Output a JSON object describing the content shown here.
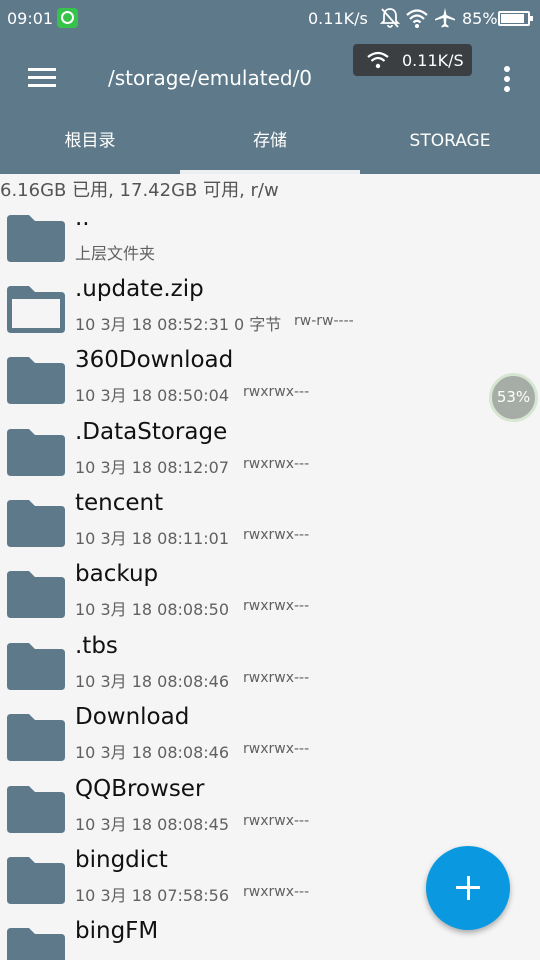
{
  "status_bar": {
    "time": "09:01",
    "net_speed": "0.11K/s",
    "battery_percent": "85%",
    "battery_level": 0.85,
    "icons": [
      "wechat-icon",
      "mute-bell-icon",
      "wifi-icon",
      "airplane-icon",
      "battery-icon"
    ]
  },
  "toolbar": {
    "path": "/storage/emulated/0",
    "speed_chip": "0.11K/S",
    "icons": [
      "menu-icon",
      "wifi-icon",
      "more-vert-icon"
    ]
  },
  "tabs": [
    {
      "label": "根目录",
      "active": false
    },
    {
      "label": "存储",
      "active": true
    },
    {
      "label": "STORAGE",
      "active": false
    }
  ],
  "storage_info": "6.16GB 已用, 17.42GB 可用, r/w",
  "files": [
    {
      "name": "..",
      "date": "上层文件夹",
      "size": "",
      "perms": "",
      "icon": "folder-icon"
    },
    {
      "name": ".update.zip",
      "date": "10 3月 18 08:52:31",
      "size": "0 字节",
      "perms": "rw-rw----",
      "icon": "archive-icon"
    },
    {
      "name": "360Download",
      "date": "10 3月 18 08:50:04",
      "size": "",
      "perms": "rwxrwx---",
      "icon": "folder-icon"
    },
    {
      "name": ".DataStorage",
      "date": "10 3月 18 08:12:07",
      "size": "",
      "perms": "rwxrwx---",
      "icon": "folder-icon"
    },
    {
      "name": "tencent",
      "date": "10 3月 18 08:11:01",
      "size": "",
      "perms": "rwxrwx---",
      "icon": "folder-icon"
    },
    {
      "name": "backup",
      "date": "10 3月 18 08:08:50",
      "size": "",
      "perms": "rwxrwx---",
      "icon": "folder-icon"
    },
    {
      "name": ".tbs",
      "date": "10 3月 18 08:08:46",
      "size": "",
      "perms": "rwxrwx---",
      "icon": "folder-icon"
    },
    {
      "name": "Download",
      "date": "10 3月 18 08:08:46",
      "size": "",
      "perms": "rwxrwx---",
      "icon": "folder-icon"
    },
    {
      "name": "QQBrowser",
      "date": "10 3月 18 08:08:45",
      "size": "",
      "perms": "rwxrwx---",
      "icon": "folder-icon"
    },
    {
      "name": "bingdict",
      "date": "10 3月 18 07:58:56",
      "size": "",
      "perms": "rwxrwx---",
      "icon": "folder-icon"
    },
    {
      "name": "bingFM",
      "date": "",
      "size": "",
      "perms": "",
      "icon": "folder-icon"
    }
  ],
  "floating_badge": "53%",
  "fab": {
    "icon": "plus-icon"
  },
  "colors": {
    "primary": "#5e7a8a",
    "folder": "#5e7a8a",
    "fab": "#0a98e0",
    "background": "#f5f5f5",
    "chip": "#3b3f42"
  }
}
